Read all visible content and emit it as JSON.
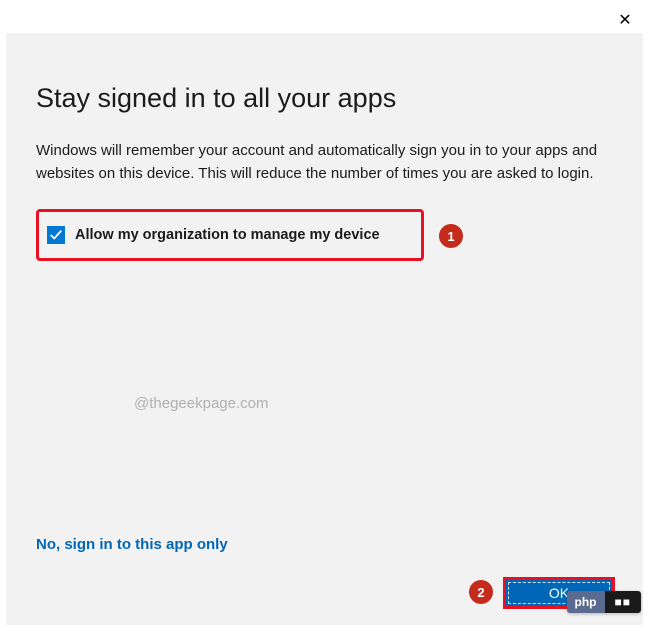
{
  "close": "✕",
  "title": "Stay signed in to all your apps",
  "description": "Windows will remember your account and automatically sign you in to your apps and websites on this device. This will reduce the number of times you are asked to login.",
  "checkbox_label": "Allow my organization to manage my device",
  "callout_1": "1",
  "callout_2": "2",
  "watermark": "@thegeekpage.com",
  "alt_link": "No, sign in to this app only",
  "ok_label": "OK",
  "badge_left": "php",
  "badge_right": "■■"
}
